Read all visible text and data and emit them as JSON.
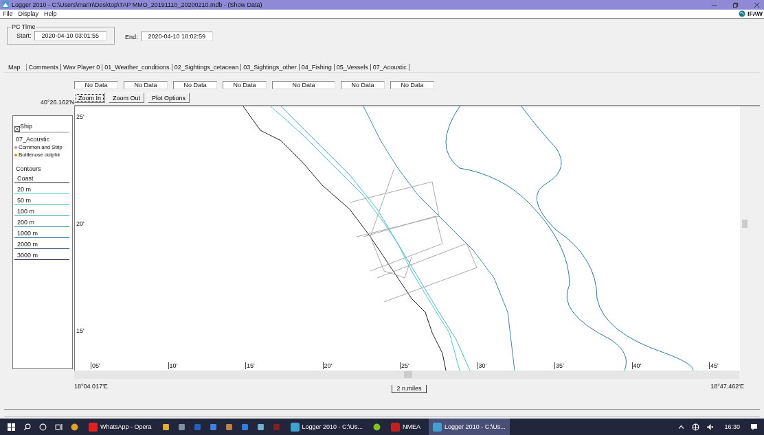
{
  "window": {
    "title": "Logger 2010 - C:\\Users\\marin\\Desktop\\TAP MMO_20191110_20200210.mdb - (Show Data)"
  },
  "menu": [
    "File",
    "Display",
    "Help"
  ],
  "logo": {
    "text": "IFAW"
  },
  "pc_time": {
    "label": "PC Time",
    "start_label": "Start:",
    "start": "2020-04-10 03:01:55",
    "end_label": "End:",
    "end": "2020-04-10 18:02:59"
  },
  "tabs": [
    {
      "label": "Map",
      "selected": true
    },
    {
      "label": "Comments",
      "selected": false
    },
    {
      "label": "Wav Player 0",
      "selected": false
    },
    {
      "label": "01_Weather_conditions",
      "selected": false
    },
    {
      "label": "02_Sightings_cetacean",
      "selected": false
    },
    {
      "label": "03_Sightings_other",
      "selected": false
    },
    {
      "label": "04_Fishing",
      "selected": false
    },
    {
      "label": "05_Vessels",
      "selected": false
    },
    {
      "label": "07_Acoustic",
      "selected": false
    }
  ],
  "readouts": [
    "No Data",
    "No Data",
    "No Data",
    "No Data",
    "No Data",
    "No Data",
    "No Data"
  ],
  "buttons": [
    {
      "label": "Zoom In",
      "focused": true
    },
    {
      "label": "Zoom Out",
      "focused": false
    },
    {
      "label": "Plot Options",
      "focused": false
    }
  ],
  "map": {
    "top_lat": "40°26.162'N",
    "y_ticks": [
      "25'",
      "20'",
      "15'"
    ],
    "x_ticks": [
      "05'",
      "10'",
      "15'",
      "20'",
      "25'",
      "30'",
      "35'",
      "40'",
      "45'"
    ],
    "left_lon": "18°04.017'E",
    "right_lon": "18°47.462'E",
    "scale": "2 n.miles"
  },
  "legend": {
    "ship": "Ship",
    "layer": "07_Acoustic",
    "species": [
      {
        "name": "Common and Strip",
        "color": "#e080c0"
      },
      {
        "name": "Bottlenose dolphir",
        "color": "#d09020"
      }
    ],
    "contours_label": "Contours",
    "contours": [
      {
        "name": "Coast",
        "color": "#1a1a1a"
      },
      {
        "name": "20 m",
        "color": "#40d0d0"
      },
      {
        "name": "50 m",
        "color": "#40c0c8"
      },
      {
        "name": "100 m",
        "color": "#40b0c0"
      },
      {
        "name": "200 m",
        "color": "#3090a8"
      },
      {
        "name": "1000 m",
        "color": "#207090"
      },
      {
        "name": "2000 m",
        "color": "#205070"
      },
      {
        "name": "3000 m",
        "color": "#202050"
      }
    ]
  },
  "taskbar": {
    "apps": [
      {
        "kind": "browser",
        "active": false
      },
      {
        "kind": "opera",
        "label": "WhatsApp - Opera",
        "active": false
      },
      {
        "kind": "logger",
        "label": "Logger 2010 - C:\\Us...",
        "active": false
      },
      {
        "kind": "qgis",
        "active": false
      },
      {
        "kind": "nmea",
        "label": "NMEA",
        "active": false
      },
      {
        "kind": "logger",
        "label": "Logger 2010 - C:\\Us...",
        "active": true
      }
    ],
    "time": "16:30"
  }
}
